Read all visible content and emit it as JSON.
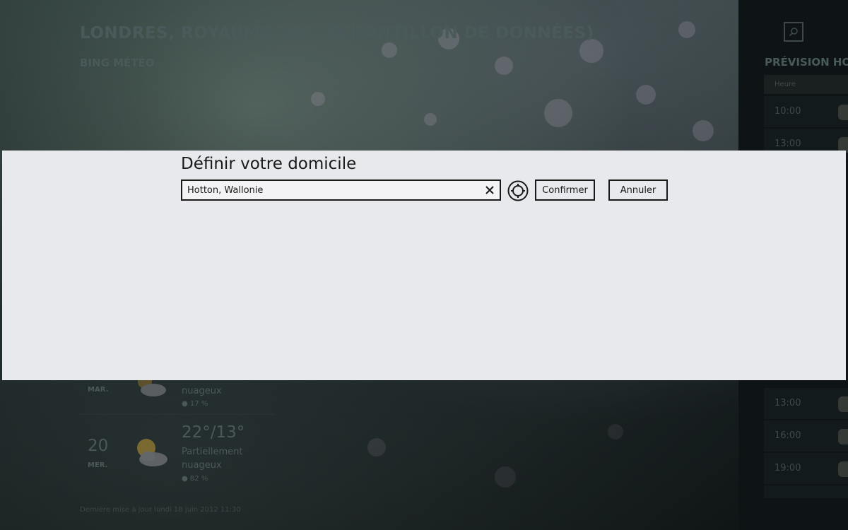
{
  "app": {
    "location_title": "LONDRES, ROYAUME-UNI (ÉCHANTILLON DE DONNÉES)",
    "subtitle": "BING MÉTÉO"
  },
  "hourly": {
    "title": "PRÉVISION HO",
    "column_header": "Heure",
    "rows": [
      {
        "time": "10:00"
      },
      {
        "time": "13:00"
      },
      {
        "time": "13:00"
      },
      {
        "time": "16:00"
      },
      {
        "time": "19:00"
      }
    ]
  },
  "daily": [
    {
      "day_name": "MAR.",
      "condition": "nuageux",
      "precip": "17 %"
    },
    {
      "day_num": "20",
      "day_name": "MER.",
      "temps": "22°/13°",
      "condition_line1": "Partiellement",
      "condition_line2": "nuageux",
      "precip": "82 %"
    }
  ],
  "footer": {
    "last_update": "Dernière mise à jour lundi 18 juin 2012 11:30"
  },
  "dialog": {
    "title": "Définir votre domicile",
    "input_value": "Hotton, Wallonie",
    "confirm_label": "Confirmer",
    "cancel_label": "Annuler"
  },
  "icons": {
    "search": "search-icon",
    "clear": "close-icon",
    "locate": "locate-icon",
    "weather": "partly-cloudy-icon",
    "precip": "raindrop-icon"
  },
  "colors": {
    "dialog_bg": "#e8e9ec",
    "dialog_text": "#1a1a1a",
    "background_dark": "#151c1d"
  }
}
